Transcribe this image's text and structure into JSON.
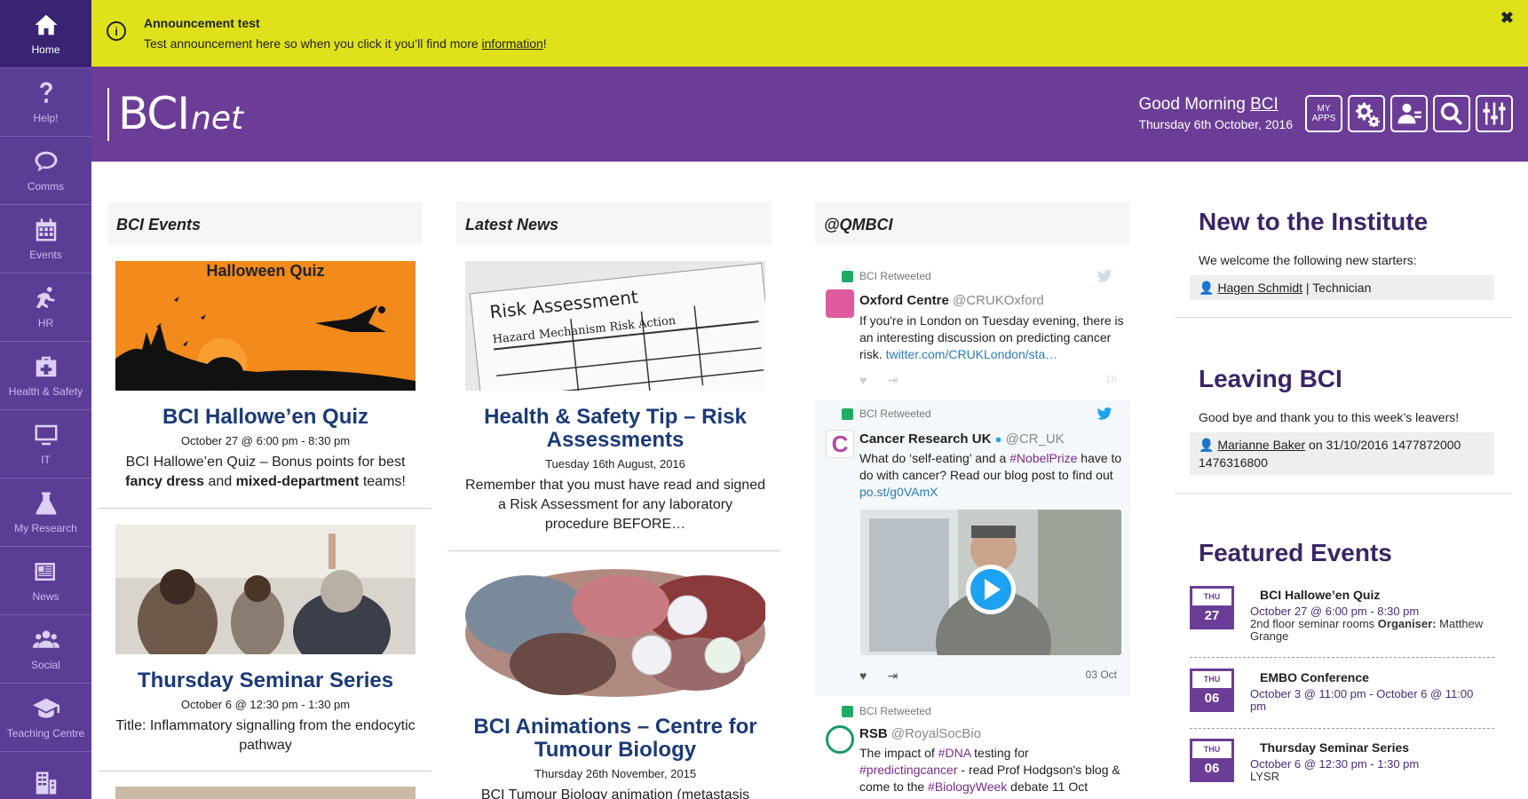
{
  "sidebar": {
    "items": [
      {
        "label": "Home",
        "icon": "home-icon"
      },
      {
        "label": "Help!",
        "icon": "question-icon"
      },
      {
        "label": "Comms",
        "icon": "chat-icon"
      },
      {
        "label": "Events",
        "icon": "calendar-icon"
      },
      {
        "label": "HR",
        "icon": "running-person-icon"
      },
      {
        "label": "Health & Safety",
        "icon": "first-aid-icon"
      },
      {
        "label": "IT",
        "icon": "monitor-icon"
      },
      {
        "label": "My Research",
        "icon": "flask-icon"
      },
      {
        "label": "News",
        "icon": "newspaper-icon"
      },
      {
        "label": "Social",
        "icon": "people-icon"
      },
      {
        "label": "Teaching Centre",
        "icon": "graduation-cap-icon"
      },
      {
        "label": "",
        "icon": "building-icon"
      }
    ]
  },
  "announcement": {
    "title": "Announcement test",
    "text_before": "Test announcement here so when you click it you’ll find more ",
    "link": "information",
    "text_after": "!",
    "close": "✖"
  },
  "header": {
    "logo_main": "BCI",
    "logo_suffix": "net",
    "greeting_prefix": "Good Morning ",
    "greeting_user": "BCI",
    "date": "Thursday 6th October, 2016",
    "my_apps_line1": "MY",
    "my_apps_line2": "APPS"
  },
  "events": {
    "heading": "BCI Events",
    "cards": [
      {
        "image_text": "Halloween Quiz",
        "title": "BCI Hallowe’en Quiz",
        "date": "October 27 @ 6:00 pm - 8:30 pm",
        "desc_1": "BCI Hallowe’en Quiz – Bonus points for best",
        "desc_b1": "fancy dress",
        "desc_2": " and ",
        "desc_b2": "mixed-department",
        "desc_3": " teams!"
      },
      {
        "title": "Thursday Seminar Series",
        "date": "October 6 @ 12:30 pm - 1:30 pm",
        "desc": "Title: Inflammatory signalling from the endocytic pathway"
      }
    ]
  },
  "news": {
    "heading": "Latest News",
    "cards": [
      {
        "image_text_1": "Risk Assessment",
        "image_text_2": "Hazard Mechanism Risk Action",
        "title": "Health & Safety Tip – Risk Assessments",
        "date": "Tuesday 16th August, 2016",
        "desc": "Remember that you must have read and signed a Risk Assessment for any laboratory procedure BEFORE…"
      },
      {
        "title": "BCI Animations – Centre for Tumour Biology",
        "date": "Thursday 26th November, 2015",
        "desc": "BCI Tumour Biology animation (metastasis"
      }
    ]
  },
  "twitter": {
    "heading": "@QMBCI",
    "tweets": [
      {
        "retweeted": "BCI Retweeted",
        "name": "Oxford Centre",
        "handle": "@CRUKOxford",
        "text": "If you're in London on Tuesday evening, there is an interesting discussion on predicting cancer risk. ",
        "link": "twitter.com/CRUKLondon/sta…",
        "time": "1h"
      },
      {
        "retweeted": "BCI Retweeted",
        "name": "Cancer Research UK",
        "handle": "@CR_UK",
        "text_1": "What do ‘self-eating’ and a ",
        "tag": "#NobelPrize",
        "text_2": " have to do with cancer? Read our blog post to find out ",
        "link": "po.st/g0VAmX",
        "time": "03 Oct"
      },
      {
        "retweeted": "BCI Retweeted",
        "name": "RSB",
        "handle": "@RoyalSocBio",
        "text_1": "The impact of ",
        "tag1": "#DNA",
        "text_2": " testing for ",
        "tag2": "#predictingcancer",
        "text_3": " - read Prof Hodgson's blog & come to the ",
        "tag3": "#BiologyWeek",
        "text_4": " debate 11 Oct"
      }
    ]
  },
  "right": {
    "new_title": "New to the Institute",
    "new_sub": "We welcome the following new starters:",
    "new_person": "Hagen Schmidt",
    "new_role": " | Technician",
    "leave_title": "Leaving BCI",
    "leave_sub": "Good bye and thank you to this week’s leavers!",
    "leave_person": "Marianne Baker",
    "leave_info": " on 31/10/2016 1477872000 1476316800",
    "featured_title": "Featured Events",
    "featured": [
      {
        "day": "THU",
        "num": "27",
        "title": "BCI Hallowe’en Quiz",
        "date": "October 27 @ 6:00 pm - 8:30 pm",
        "extra_1": "2nd floor seminar rooms ",
        "extra_b": "Organiser:",
        "extra_2": " Matthew Grange"
      },
      {
        "day": "THU",
        "num": "06",
        "title": "EMBO Conference",
        "date": "October 3 @ 11:00 pm - October 6 @ 11:00 pm"
      },
      {
        "day": "THU",
        "num": "06",
        "title": "Thursday Seminar Series",
        "date": "October 6 @ 12:30 pm - 1:30 pm",
        "extra_1": "LYSR"
      }
    ]
  },
  "colors": {
    "sidebar": "#5b3d96",
    "header": "#6b3d97",
    "announcement": "#dfe21a",
    "title_blue": "#1b3a78"
  }
}
